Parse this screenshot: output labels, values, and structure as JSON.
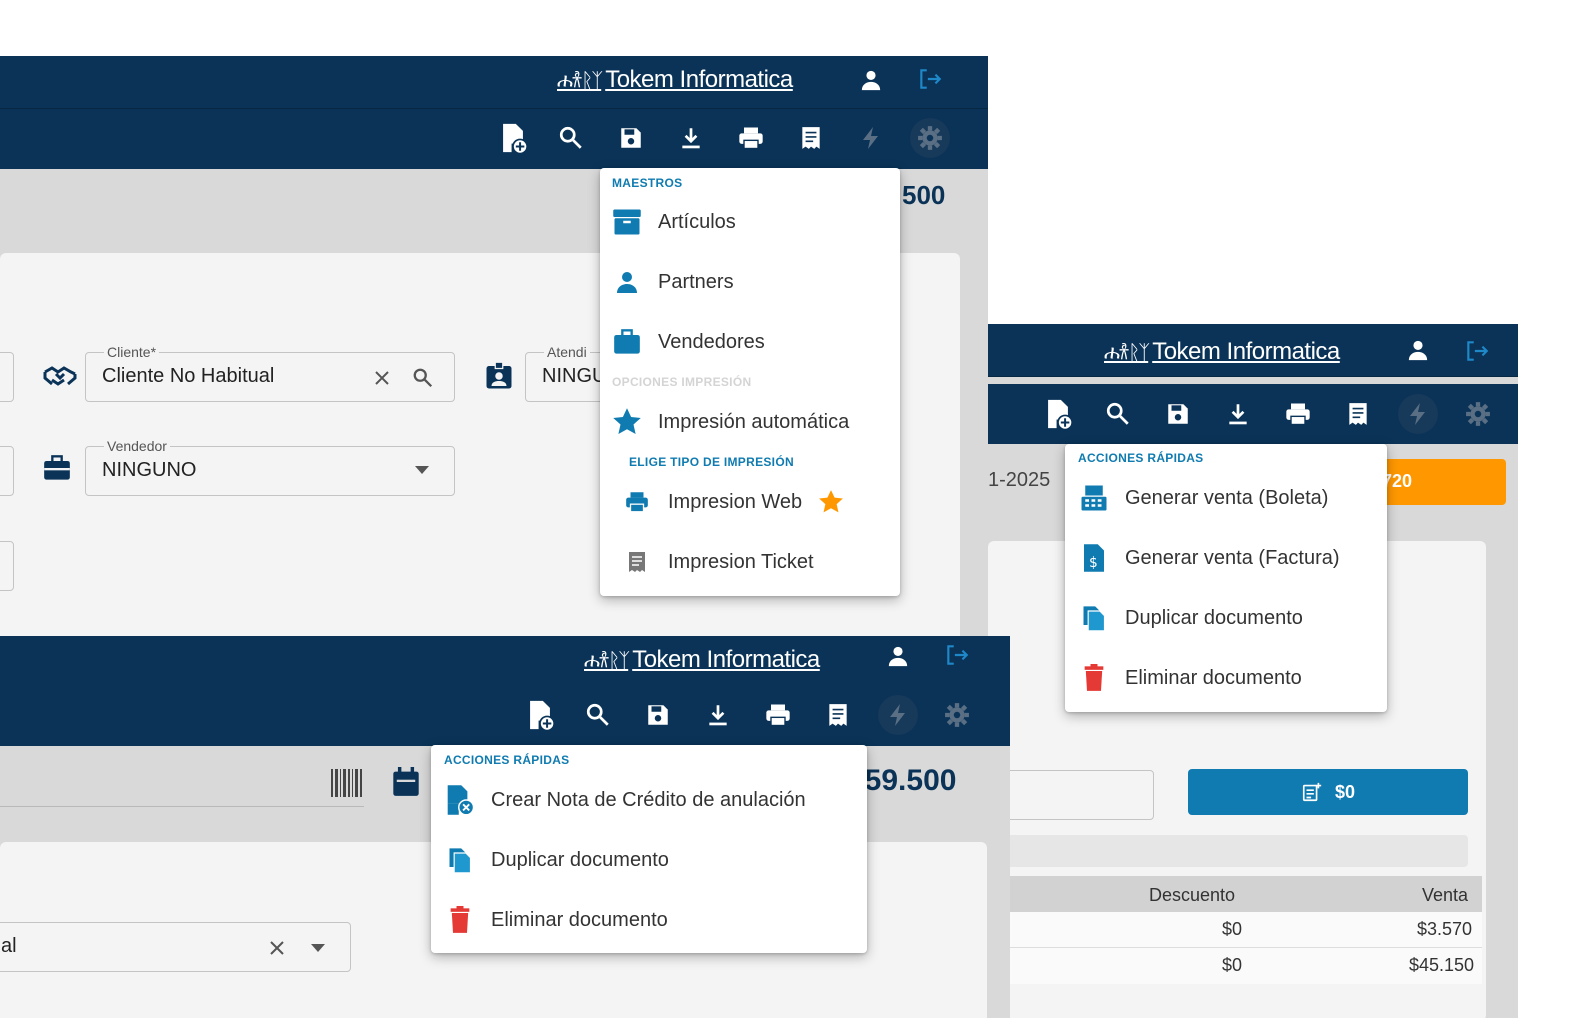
{
  "brand": {
    "name": "Tokem Informatica",
    "figures": "ሐ𐀪ᚱᛉ"
  },
  "colors": {
    "navbar": "#0a3357",
    "accent": "#0f7bb0",
    "orange": "#ff9800",
    "danger": "#e53935"
  },
  "toolbar_icons": [
    "new-document-icon",
    "search-icon",
    "save-icon",
    "download-icon",
    "print-icon",
    "receipt-icon",
    "lightning-icon",
    "gear-icon"
  ],
  "panel_top": {
    "total_partial": "500",
    "fields": {
      "cliente": {
        "label": "Cliente*",
        "value": "Cliente No Habitual"
      },
      "atendido": {
        "label": "Atendi",
        "value": "NINGU"
      },
      "vendedor": {
        "label": "Vendedor",
        "value": "NINGUNO"
      }
    },
    "settings_menu": {
      "section_maestros": "MAESTROS",
      "maestros": [
        {
          "label": "Artículos",
          "icon": "package-icon"
        },
        {
          "label": "Partners",
          "icon": "person-icon"
        },
        {
          "label": "Vendedores",
          "icon": "briefcase-icon"
        }
      ],
      "section_opciones": "OPCIONES IMPRESIÓN",
      "impresion_automatica": "Impresión automática",
      "section_tipo": "ELIGE TIPO DE IMPRESIÓN",
      "tipos": [
        {
          "label": "Impresion Web",
          "icon": "print-icon",
          "favorite": true
        },
        {
          "label": "Impresion Ticket",
          "icon": "receipt-icon",
          "favorite": false
        }
      ]
    }
  },
  "panel_right": {
    "date_partial": "1-2025",
    "badge_partial": "720",
    "button_amount": "$0",
    "quick_menu": {
      "section": "ACCIONES RÁPIDAS",
      "items": [
        {
          "label": "Generar venta (Boleta)",
          "icon": "cash-register-icon"
        },
        {
          "label": "Generar venta (Factura)",
          "icon": "invoice-dollar-icon"
        },
        {
          "label": "Duplicar documento",
          "icon": "copy-icon"
        },
        {
          "label": "Eliminar documento",
          "icon": "trash-icon"
        }
      ]
    },
    "table": {
      "headers": [
        "Descuento",
        "Venta"
      ],
      "rows": [
        [
          "$0",
          "$3.570"
        ],
        [
          "$0",
          "$45.150"
        ]
      ]
    }
  },
  "panel_bottom": {
    "total": "$59.500",
    "field_partial": "al",
    "quick_menu": {
      "section": "ACCIONES RÁPIDAS",
      "items": [
        {
          "label": "Crear Nota de Crédito de anulación",
          "icon": "credit-note-cancel-icon"
        },
        {
          "label": "Duplicar documento",
          "icon": "copy-icon"
        },
        {
          "label": "Eliminar documento",
          "icon": "trash-icon"
        }
      ]
    }
  }
}
